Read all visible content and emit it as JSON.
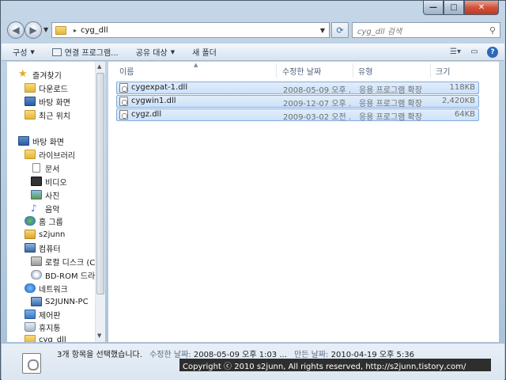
{
  "window": {
    "caption_min": "—",
    "caption_max": "□",
    "caption_close": "✕"
  },
  "address_bar": {
    "path": "cyg_dll",
    "separator": "▸",
    "search_placeholder": "cyg_dll 검색"
  },
  "toolbar": {
    "organize": "구성",
    "open_with": "연결 프로그램...",
    "share_with": "공유 대상",
    "new_folder": "새 폴더"
  },
  "nav_pane": {
    "items": [
      {
        "label": "즐겨찾기",
        "icon": "star-icon"
      },
      {
        "label": "다운로드",
        "icon": "folder-icon"
      },
      {
        "label": "바탕 화면",
        "icon": "desktop-icon"
      },
      {
        "label": "최근 위치",
        "icon": "folder-icon"
      },
      {
        "label": "바탕 화면",
        "icon": "desktop-icon"
      },
      {
        "label": "라이브러리",
        "icon": "folder-icon"
      },
      {
        "label": "문서",
        "icon": "document-icon"
      },
      {
        "label": "비디오",
        "icon": "film-icon"
      },
      {
        "label": "사진",
        "icon": "picture-icon"
      },
      {
        "label": "음악",
        "icon": "music-icon"
      },
      {
        "label": "홈 그룹",
        "icon": "homegroup-icon"
      },
      {
        "label": "s2junn",
        "icon": "user-folder-icon"
      },
      {
        "label": "컴퓨터",
        "icon": "computer-icon"
      },
      {
        "label": "로컬 디스크 (C",
        "icon": "disk-icon"
      },
      {
        "label": "BD-ROM 드라",
        "icon": "cd-drive-icon"
      },
      {
        "label": "네트워크",
        "icon": "network-icon"
      },
      {
        "label": "S2JUNN-PC",
        "icon": "computer-icon"
      },
      {
        "label": "제어판",
        "icon": "control-panel-icon"
      },
      {
        "label": "휴지통",
        "icon": "recycle-bin-icon"
      },
      {
        "label": "cyg_dll",
        "icon": "folder-icon"
      }
    ]
  },
  "file_list": {
    "columns": [
      "이름",
      "수정한 날짜",
      "유형",
      "크기"
    ],
    "rows": [
      {
        "name": "cygexpat-1.dll",
        "modified": "2008-05-09 오후 ...",
        "type": "응용 프로그램 확장",
        "size": "118KB"
      },
      {
        "name": "cygwin1.dll",
        "modified": "2009-12-07 오후 ...",
        "type": "응용 프로그램 확장",
        "size": "2,420KB"
      },
      {
        "name": "cygz.dll",
        "modified": "2009-03-02 오전 ...",
        "type": "응용 프로그램 확장",
        "size": "64KB"
      }
    ]
  },
  "details": {
    "selection": "3개 항목을 선택했습니다.",
    "modified_label": "수정한 날짜:",
    "modified_value": "2008-05-09 오후 1:03 ...",
    "created_label": "만든 날짜:",
    "created_value": "2010-04-19 오후 5:36",
    "copyright": "Copyright ⓒ 2010 s2junn, All rights reserved, http://s2junn,tistory,com/"
  }
}
